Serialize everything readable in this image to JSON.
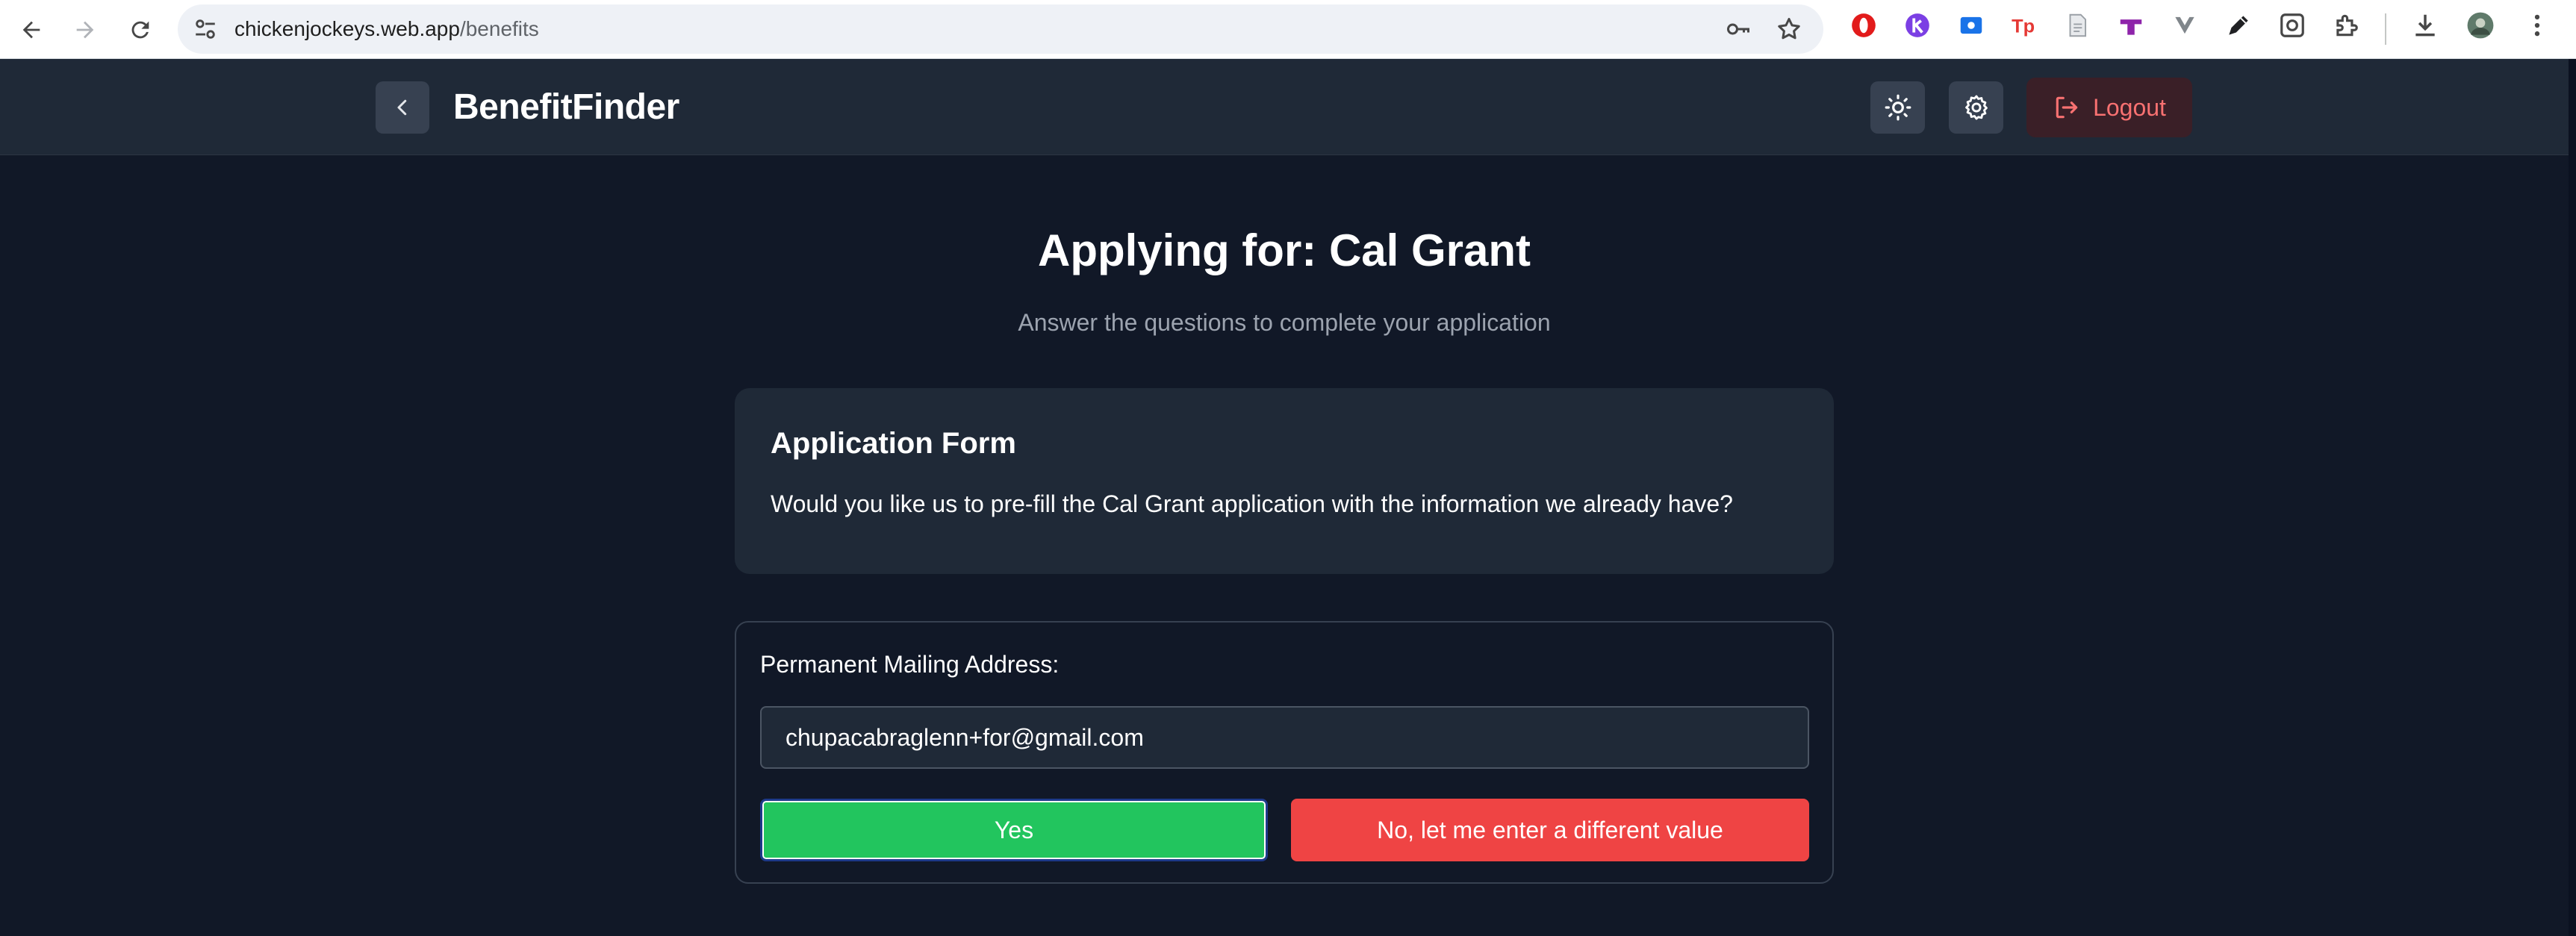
{
  "browser": {
    "url_host": "chickenjockeys.web.app",
    "url_path": "/benefits",
    "icons": {
      "back": "back-arrow-icon",
      "forward": "forward-arrow-icon",
      "reload": "reload-icon",
      "site_settings": "tune-icon",
      "password": "key-icon",
      "bookmark": "star-icon",
      "extensions": "puzzle-icon",
      "downloads": "download-icon",
      "menu": "more-vert-icon"
    },
    "extension_badge_text": "Tp"
  },
  "header": {
    "brand": "BenefitFinder",
    "logout_label": "Logout",
    "logout_color": "#f87171",
    "icons": {
      "back": "chevron-left-icon",
      "theme": "sun-icon",
      "settings": "gear-icon",
      "logout": "logout-icon"
    }
  },
  "main": {
    "title": "Applying for: Cal Grant",
    "subtitle": "Answer the questions to complete your application"
  },
  "form_card": {
    "title": "Application Form",
    "question": "Would you like us to pre-fill the Cal Grant application with the information we already have?"
  },
  "field": {
    "label": "Permanent Mailing Address:",
    "value": "chupacabraglenn+for@gmail.com",
    "yes_label": "Yes",
    "no_label": "No, let me enter a different value",
    "yes_color": "#22c55e",
    "no_color": "#ef4444"
  },
  "colors": {
    "background": "#111827",
    "surface": "#1f2937",
    "muted_text": "#9ca3af"
  }
}
